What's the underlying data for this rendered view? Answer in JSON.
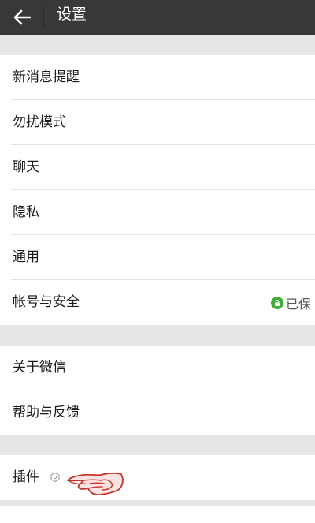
{
  "header": {
    "back_icon": "arrow-left-icon",
    "title": "设置"
  },
  "group1": {
    "items": [
      {
        "label": "新消息提醒"
      },
      {
        "label": "勿扰模式"
      },
      {
        "label": "聊天"
      },
      {
        "label": "隐私"
      },
      {
        "label": "通用"
      },
      {
        "label": "帐号与安全",
        "status": "已保",
        "status_icon": "lock-icon"
      }
    ]
  },
  "group2": {
    "items": [
      {
        "label": "关于微信"
      },
      {
        "label": "帮助与反馈"
      }
    ]
  },
  "group3": {
    "items": [
      {
        "label": "插件",
        "icon": "plugin-icon",
        "annotation": "pointing-hand-icon"
      }
    ]
  },
  "colors": {
    "header_bg": "#383838",
    "page_bg": "#e6e6e6",
    "secure_green": "#3caf37",
    "annotation_red": "#c8332a"
  }
}
